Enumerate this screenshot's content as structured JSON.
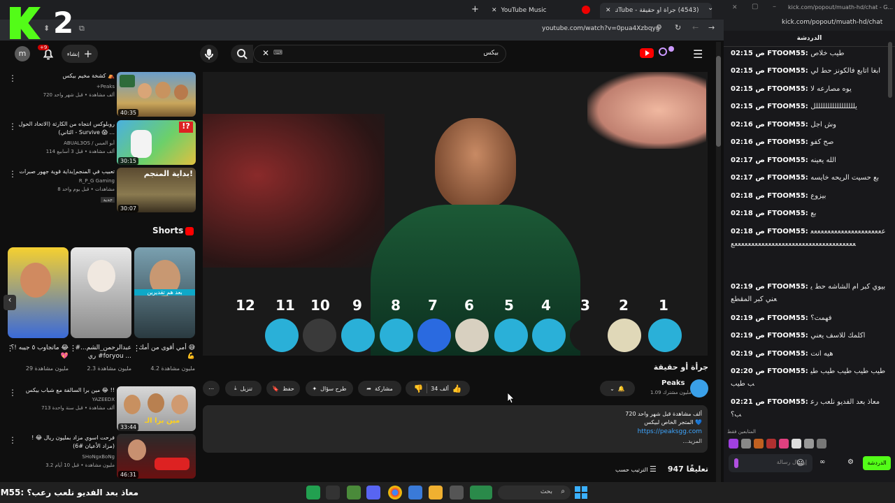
{
  "browser": {
    "tabs": [
      {
        "label": "(4543) جرأة أو حقيقة - YouTube"
      },
      {
        "label": "YouTube Music"
      }
    ],
    "address": "youtube.com/watch?v=0pua4Xzbqyg",
    "chat_url": "kick.com/popout/muath-hd/chat - G...",
    "chat_url_short": "kick.com/popout/muath-hd/chat"
  },
  "youtube": {
    "search_value": "بيكس",
    "create_label": "إنشاء",
    "notif_badge": "+9",
    "avatar_letter": "m",
    "video": {
      "title": "جرأة أو حقيقة",
      "channel": "Peaks",
      "subs": "1.09 مليون مشترك",
      "likes": "34 ألف",
      "share": "مشاركة",
      "ask": "طرح سؤال",
      "save": "حفظ",
      "download": "تنزيل",
      "desc_line1": "720 ألف مشاهدة  قبل شهر واحد",
      "desc_line2": "المتجر الخاص لبيكس 💙",
      "desc_link": "https://peaksgg.com",
      "desc_more": "...المزيد",
      "comments": "947 تعليقًا",
      "sort": "الترتيب حسب",
      "numbers": [
        "12",
        "11",
        "10",
        "9",
        "8",
        "7",
        "6",
        "5",
        "4",
        "3",
        "2",
        "1"
      ]
    },
    "sidebar": [
      {
        "title": "كشخة مخيم بيكس ⛺",
        "channel": "Peaks",
        "meta": "720 ألف مشاهدة • قبل شهر واحد",
        "duration": "40:35",
        "extra": "+Peaks"
      },
      {
        "title": "روبلوكس انتجاه من الكارثة (الاتحاد الحول الثاني) - Survive 😱 ...",
        "channel": "ABUAL3OS / أبو العبس",
        "meta": "114 ألف مشاهدة • قبل 3 أسابيع",
        "duration": "30:15"
      },
      {
        "title": "تعبيب في المنجم|بداية قوية جهور صبرات",
        "channel": "R_P_G Gaming",
        "meta": "8 مشاهدات • قبل يوم واحد",
        "duration": "30:07",
        "badge": "جديد"
      }
    ],
    "shorts_label": "Shorts",
    "shorts": [
      {
        "title": "أمي أقوى من أمك 😅💪",
        "views": "4.2 مليون مشاهدة",
        "caption": "بعد هم تقديرين"
      },
      {
        "title": "#عبدالرحمن_الشم... ري #foryou ...",
        "views": "2.3 مليون مشاهدة"
      },
      {
        "title": "ماتجاوب ٥ جيبه !؟ 😂💖",
        "views": "29 مليون مشاهدة"
      }
    ],
    "sidebar2": [
      {
        "title": "مين برا السالفة مع شباب بيكس 😂 !!",
        "channel": "YAZEEDX",
        "meta": "713 ألف مشاهدة • قبل سنة واحدة",
        "duration": "33:44",
        "thumb_text": "مين برا الـ"
      },
      {
        "title": "فرحت اسوي مزاد بمليون ريال 😂 ! (مزاد الأعيان #6)",
        "channel": "SHoNgxBoNg",
        "meta": "3.2 مليون مشاهدة • قبل 10 أيام",
        "duration": "46:31"
      }
    ]
  },
  "chat": {
    "header": "الدردشة",
    "messages": [
      {
        "time": "02:15",
        "user": "FTOOM55",
        "text": "طيب خلاص"
      },
      {
        "time": "02:15",
        "user": "FTOOM55",
        "text": "ابغا اتابع فالكونز حط لي"
      },
      {
        "time": "02:15",
        "user": "FTOOM55",
        "text": "يوه مصارعه لا"
      },
      {
        "time": "02:15",
        "user": "FTOOM55",
        "text": "يلللللللللللللللللل"
      },
      {
        "time": "02:16",
        "user": "FTOOM55",
        "text": "وش اجل"
      },
      {
        "time": "02:16",
        "user": "FTOOM55",
        "text": "صح كفو"
      },
      {
        "time": "02:17",
        "user": "FTOOM55",
        "text": "الله يعينه"
      },
      {
        "time": "02:17",
        "user": "FTOOM55",
        "text": "بع حسيت الريحه خايسه"
      },
      {
        "time": "02:18",
        "user": "FTOOM55",
        "text": "بيزوع"
      },
      {
        "time": "02:18",
        "user": "FTOOM55",
        "text": "بع"
      },
      {
        "time": "02:18",
        "user": "FTOOM55",
        "text": "ععععععععععععععععععععععععععععععععععععععععععععععععععععععععععع"
      },
      {
        "time": "02:19",
        "user": "FTOOM55",
        "text": "بيوي كبر ام الشاشه حط يعني كبر المقطع"
      },
      {
        "time": "02:19",
        "user": "FTOOM55",
        "text": "فهمت؟"
      },
      {
        "time": "02:19",
        "user": "FTOOM55",
        "text": "اكلمك للاسف يعني"
      },
      {
        "time": "02:19",
        "user": "FTOOM55",
        "text": "هيه انت"
      },
      {
        "time": "02:20",
        "user": "FTOOM55",
        "text": "طيب طيب طيب طيب طيب طيب"
      },
      {
        "time": "02:21",
        "user": "FTOOM55",
        "text": "معاذ بعد الفديو نلعب رعب؟"
      }
    ],
    "time_prefix": "ص",
    "emote_bar_label": "المتابعين فقط",
    "send_placeholder": "إرسال رسالة",
    "send_button": "الدردشة"
  },
  "taskbar": {
    "ticker": "معاذ بعد الفديو نلعب رعب؟ :FTOOM55",
    "search": "بحث"
  },
  "colors": {
    "kick_green": "#53fc18",
    "yt_red": "#ff0000",
    "link": "#3ea6ff"
  }
}
